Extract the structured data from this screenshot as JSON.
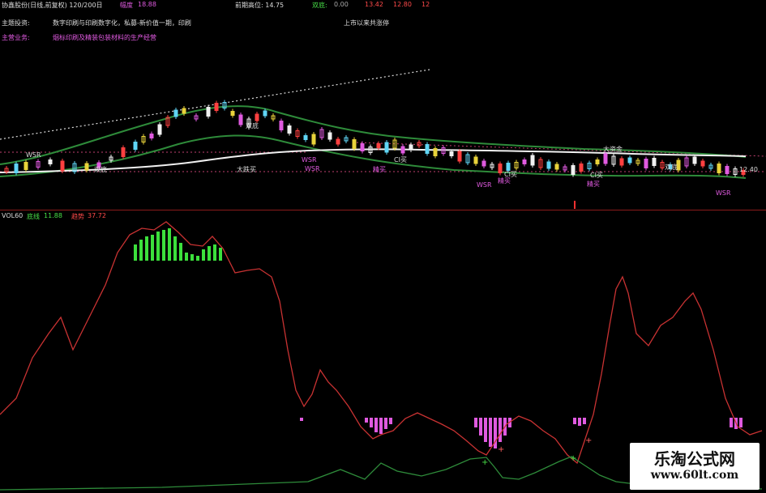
{
  "header": {
    "stock_title": "协鑫股份(日线,前复权) 120/200日",
    "indicator_label": "幅度",
    "indicator_value": "18.88",
    "prev_high_label": "前期高位: 14.75",
    "double_bottom_label": "双底:",
    "double_bottom_value": "0.00",
    "val_a": "13.42",
    "val_b": "12.80",
    "val_c": "12"
  },
  "theme": {
    "theme_label": "主题投资:",
    "theme_text": "数字印刷与印刷数字化，私募-新价值一期，印刷",
    "ipo_text": "上市以来共涨停",
    "business_label": "主营业务:",
    "business_text": "烟标印刷及精装包装材料的生产经营"
  },
  "annotations": {
    "wr_top": "WSR",
    "shuangdi_1": "双底",
    "shuangdi_2": "双底",
    "shuangdi_3": "双底",
    "dazhangmai": "大跌买",
    "wr_1": "WSR",
    "wr_2": "WSR",
    "wr_3": "WSR",
    "wr_4": "WSR",
    "jingmai_1": "精买",
    "jingmai_2": "精买",
    "jingmai_3": "精买",
    "ci_1": "CI买",
    "ci_2": "CI买",
    "ci_3": "CI买",
    "dazijin": "大资金",
    "last_price": "12.40"
  },
  "volume_pane": {
    "name": "VOL60",
    "low_label": "底线",
    "low_value": "11.88",
    "trend_label": "趋势",
    "trend_value": "37.72"
  },
  "watermark": {
    "title": "乐淘公式网",
    "url": "www.60lt.com"
  },
  "colors": {
    "background": "#000000",
    "red_line": "#c83232",
    "green_line": "#2e8b3a",
    "green_bar": "#3ce03c",
    "magenta_bar": "#e05ae0",
    "up_candle": "#ff4040",
    "down_candle": "#5fd5f5"
  }
}
